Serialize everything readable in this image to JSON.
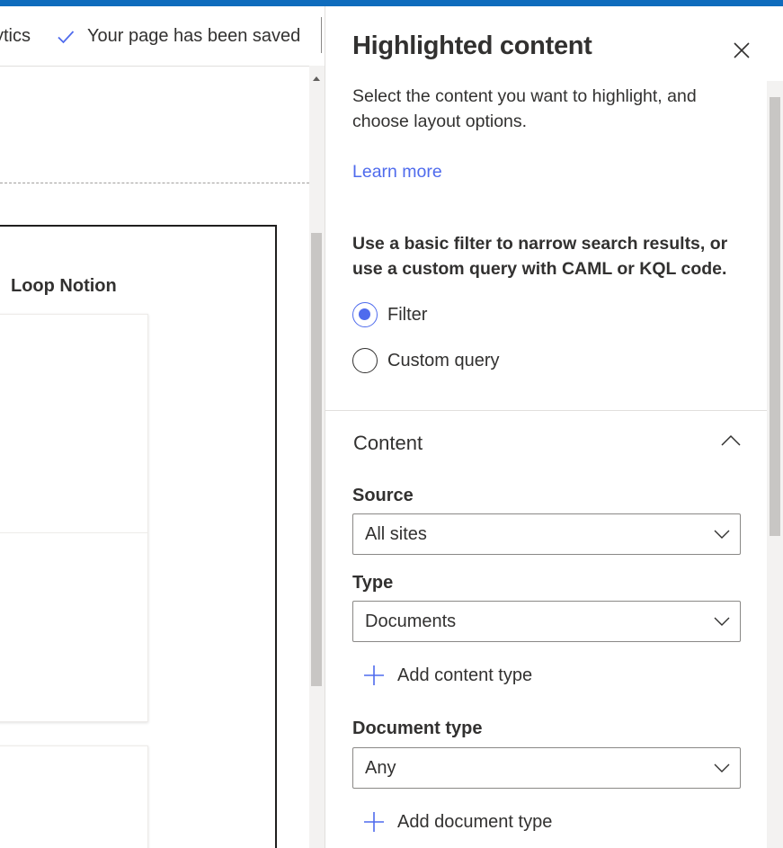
{
  "command_bar": {
    "analytics_label": "ytics",
    "saved_status": "Your page has been saved"
  },
  "canvas": {
    "card_title": "Loop Notion"
  },
  "panel": {
    "title": "Highlighted content",
    "description": "Select the content you want to highlight, and choose layout options.",
    "learn_more": "Learn more",
    "filter_description": "Use a basic filter to narrow search results, or use a custom query with CAML or KQL code.",
    "mode_options": [
      {
        "label": "Filter",
        "selected": true
      },
      {
        "label": "Custom query",
        "selected": false
      }
    ],
    "content_section": {
      "heading": "Content",
      "source": {
        "label": "Source",
        "value": "All sites"
      },
      "type": {
        "label": "Type",
        "value": "Documents"
      },
      "add_content_type": "Add content type",
      "document_type": {
        "label": "Document type",
        "value": "Any"
      },
      "add_document_type": "Add document type"
    }
  },
  "icons": {
    "saved": "checkmark-icon",
    "close": "close-icon",
    "collapse": "chevron-up-icon",
    "dropdown": "chevron-down-icon",
    "add": "plus-icon"
  },
  "colors": {
    "accent": "#4f6bed",
    "top_bar": "#0f6cbd",
    "text": "#323130"
  }
}
